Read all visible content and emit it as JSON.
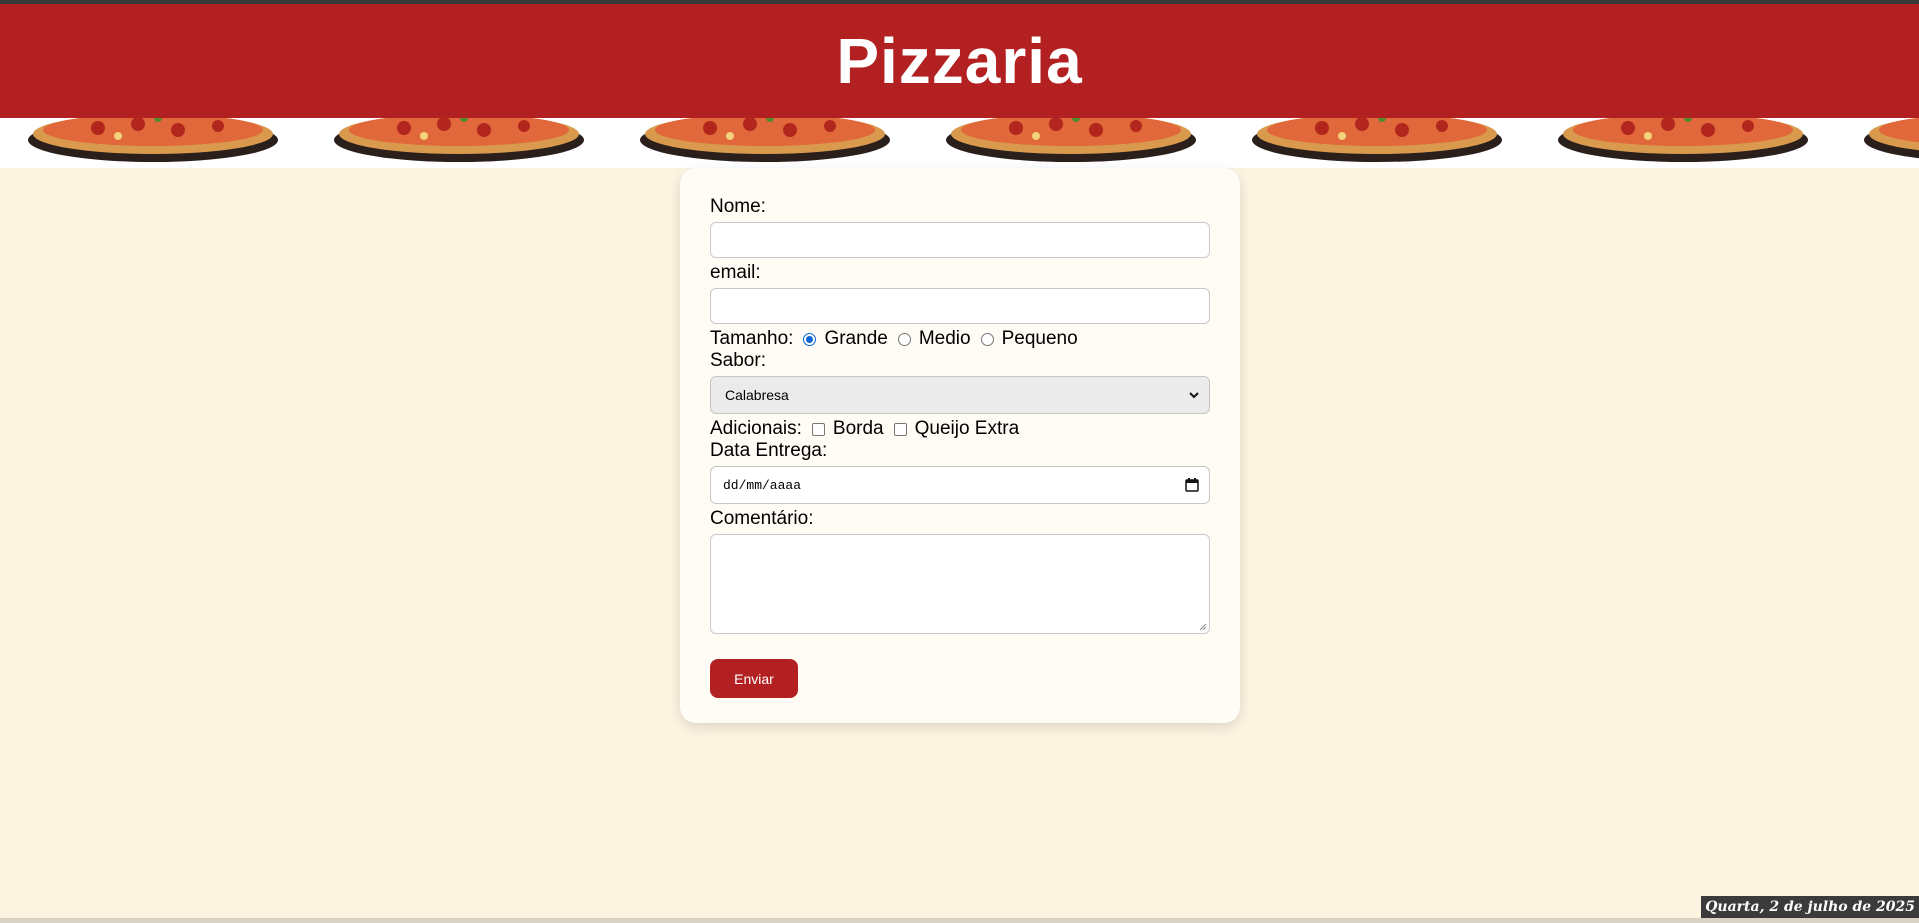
{
  "header": {
    "title": "Pizzaria"
  },
  "form": {
    "nome_label": "Nome:",
    "nome_value": "",
    "email_label": "email:",
    "email_value": "",
    "tamanho_label": "Tamanho:",
    "tamanho_options": [
      {
        "label": "Grande",
        "checked": true
      },
      {
        "label": "Medio",
        "checked": false
      },
      {
        "label": "Pequeno",
        "checked": false
      }
    ],
    "sabor_label": "Sabor:",
    "sabor_selected": "Calabresa",
    "adicionais_label": "Adicionais:",
    "adicionais_options": [
      {
        "label": "Borda",
        "checked": false
      },
      {
        "label": "Queijo Extra",
        "checked": false
      }
    ],
    "data_label": "Data Entrega:",
    "data_placeholder": "dd/mm/aaaa",
    "comentario_label": "Comentário:",
    "comentario_value": "",
    "submit_label": "Enviar"
  },
  "footer": {
    "date_text": "Quarta, 2 de julho de 2025"
  },
  "colors": {
    "brand_red": "#b22022",
    "page_bg": "#fcf3e0",
    "card_bg": "#fffcf5",
    "radio_accent": "#0a66d8"
  }
}
